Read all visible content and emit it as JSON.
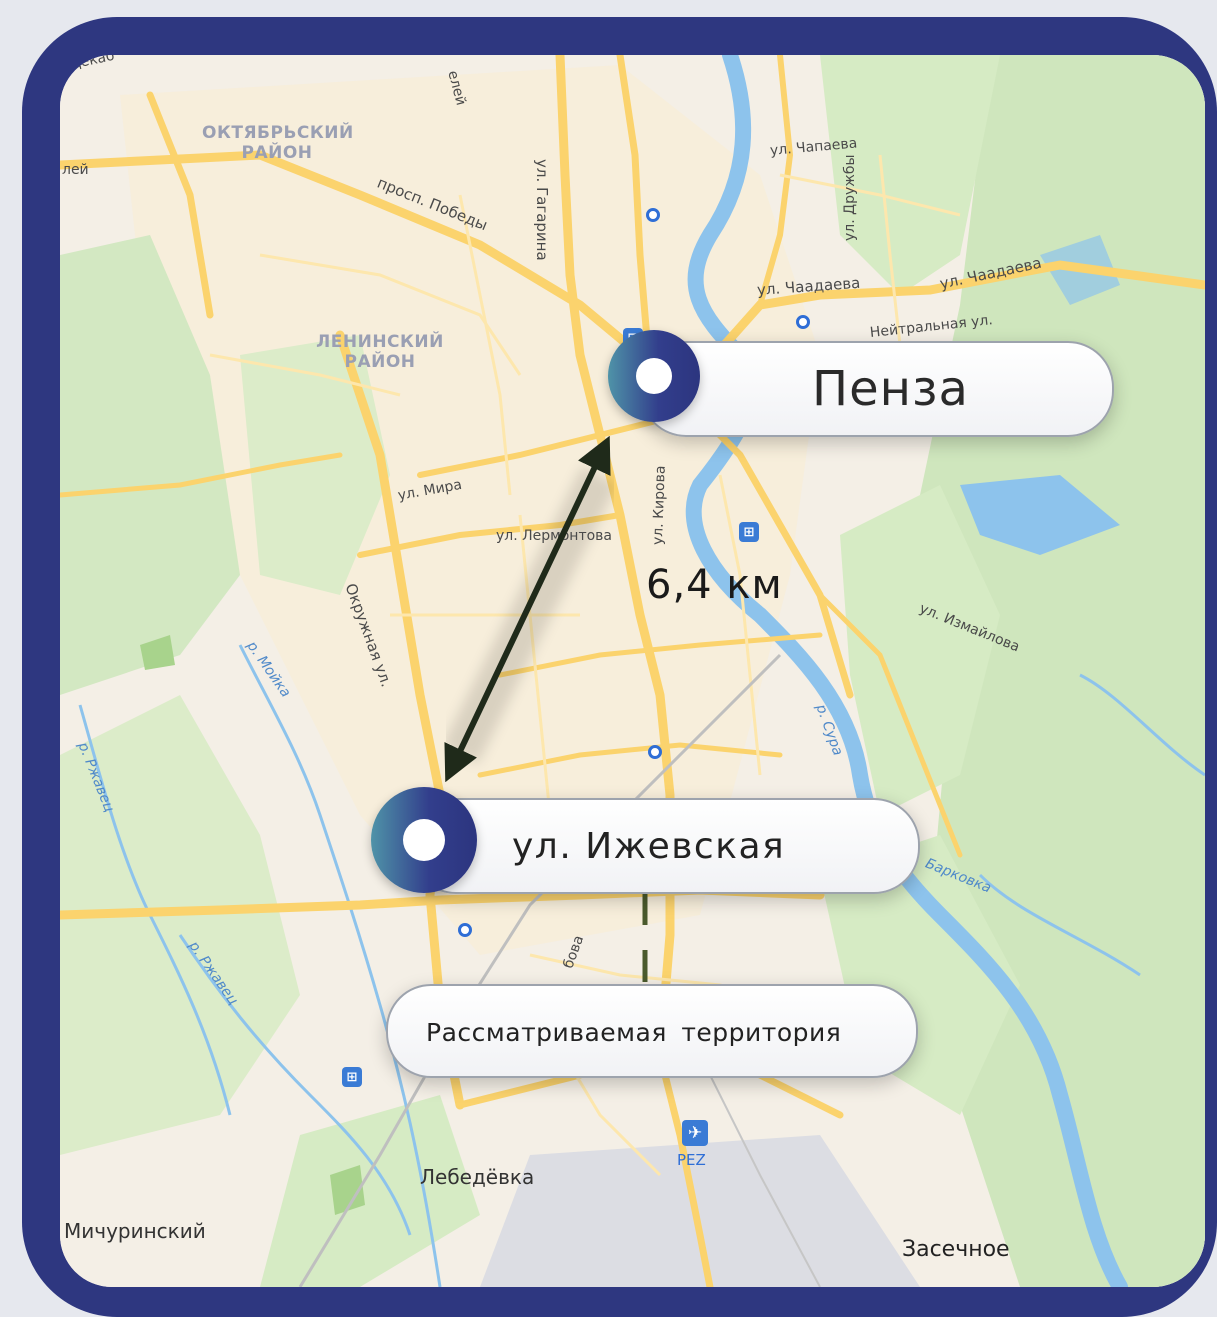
{
  "origin": {
    "name": "Пенза"
  },
  "site": {
    "name": "ул. Ижевская"
  },
  "area": {
    "label": "Рассматриваемая территория"
  },
  "distance": {
    "label": "6,4 км"
  },
  "districts": {
    "oktyabrsky": "ОКТЯБРЬСКИЙ РАЙОН",
    "leninsky": "ЛЕНИНСКИЙ РАЙОН"
  },
  "streets": {
    "gagarina": "ул. Гагарина",
    "pobedy": "просп. Победы",
    "chapaeva": "ул. Чапаева",
    "druzhby": "ул. Дружбы",
    "chaadaeva1": "ул. Чаадаева",
    "chaadaeva2": "ул. Чаадаева",
    "neitralnaya": "Нейтральная ул.",
    "mira": "ул. Мира",
    "lermontova": "ул. Лермонтова",
    "kirova": "ул. Кирова",
    "izmailova": "ул. Измайлова",
    "okruzhnaya": "Окружная ул.",
    "bobova": "бова",
    "lei": "лей",
    "elei": "елей",
    "deka": "Декаб"
  },
  "rivers": {
    "moika": "р. Мойка",
    "rzhavets1": "р. Ржавец",
    "rzhavets2": "р. Ржавец",
    "sura": "р. Сура",
    "barkovka": "Барковка"
  },
  "places": {
    "lebedevka": "Лебедёвка",
    "michurinsky": "Мичуринский",
    "zasechnoe": "Засечное"
  },
  "airport": {
    "code": "PEZ"
  },
  "colors": {
    "frame": "#2e3780",
    "map_background": "#f4efe6",
    "forest": "#cfe6bd",
    "water": "#8dc3ec",
    "road": "#fbd36d",
    "arrow": "#1f2a1a",
    "marker_gradient_start": "#4f93a8",
    "marker_gradient_end": "#2c357f"
  },
  "icons": {
    "marker": "location-ring-icon",
    "poi": "station-icon",
    "airport": "airplane-icon",
    "metro": "transit-dot-icon"
  }
}
